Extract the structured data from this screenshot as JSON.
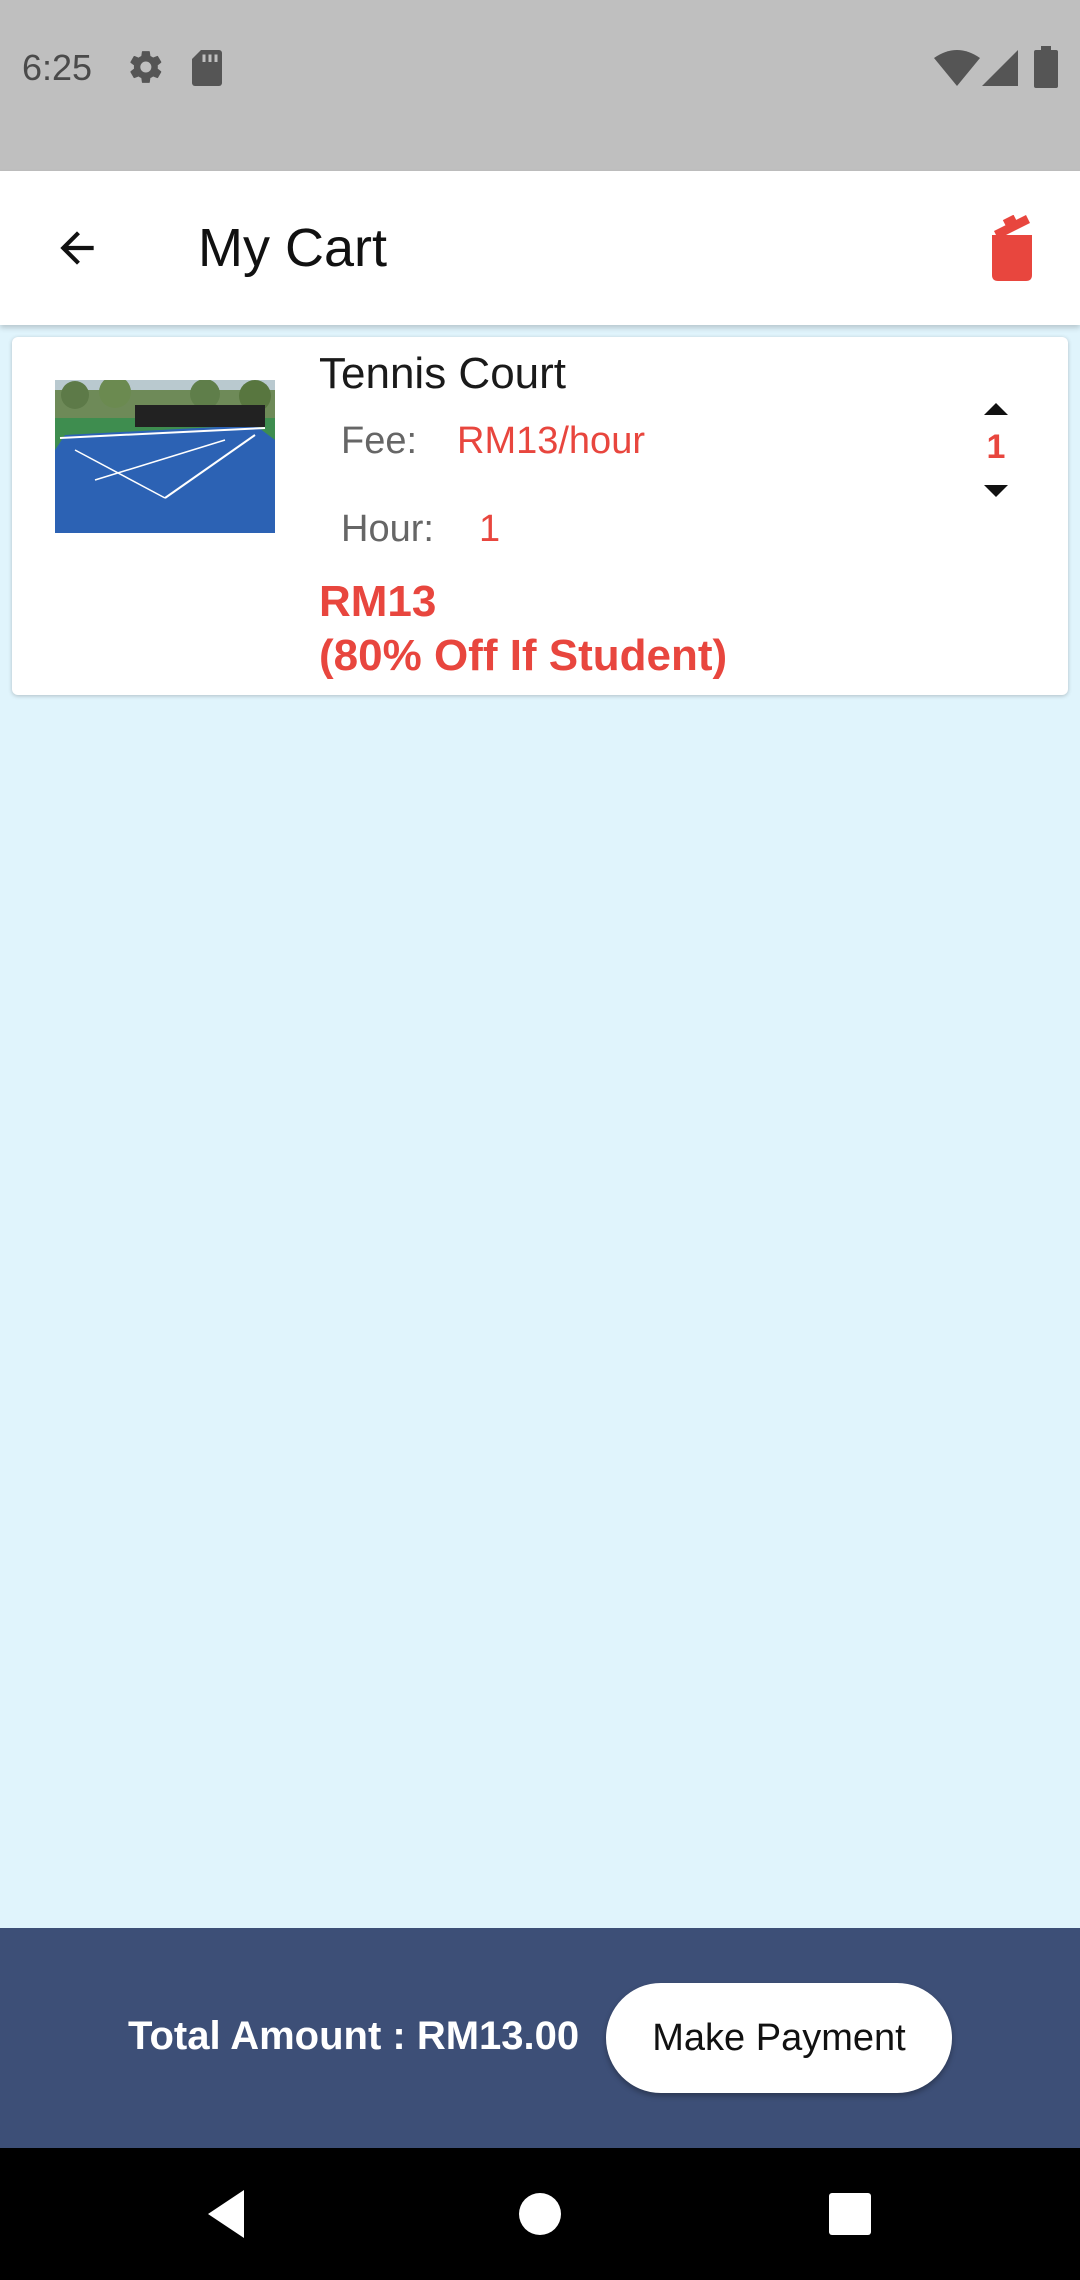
{
  "status_bar": {
    "time": "6:25",
    "icons": [
      "gear-icon",
      "sd-card-icon",
      "wifi-icon",
      "signal-icon",
      "battery-icon"
    ]
  },
  "app_bar": {
    "title": "My Cart",
    "back_icon": "arrow-left-icon",
    "action_icon": "trash-icon",
    "action_color": "#e8463e"
  },
  "cart": {
    "items": [
      {
        "name": "Tennis Court",
        "image": "tennis-court-photo",
        "fee_label": "Fee:",
        "fee_value": "RM13/hour",
        "hour_label": "Hour:",
        "hour_value": "1",
        "price": "RM13",
        "discount_note": "(80% Off If Student)",
        "quantity": "1"
      }
    ]
  },
  "summary": {
    "total_text": "Total Amount : RM13.00",
    "pay_button_label": "Make Payment"
  },
  "colors": {
    "accent_red": "#e8463e",
    "summary_bg": "#3d4f77",
    "page_bg": "#e0f4fc"
  }
}
